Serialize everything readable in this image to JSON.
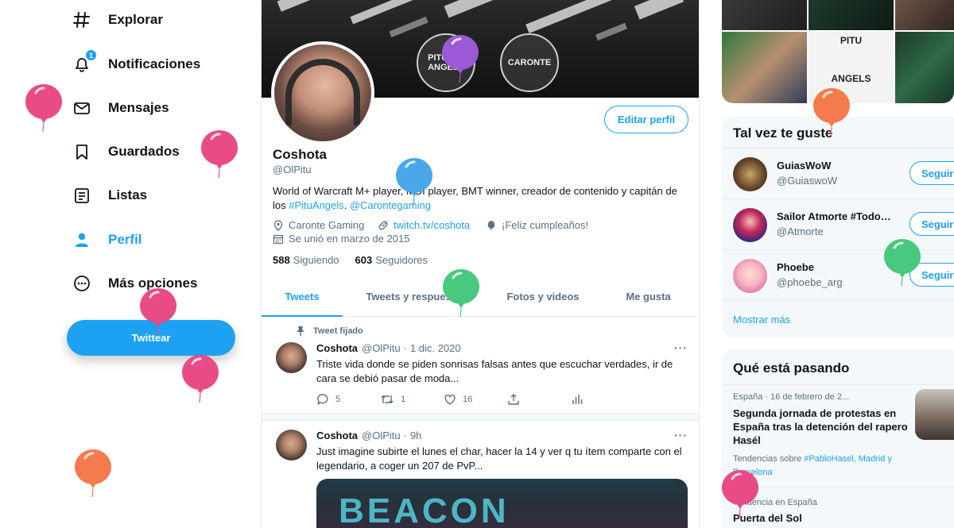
{
  "nav": {
    "items": [
      {
        "label": "Explorar"
      },
      {
        "label": "Notificaciones",
        "badge": "1"
      },
      {
        "label": "Mensajes"
      },
      {
        "label": "Guardados"
      },
      {
        "label": "Listas"
      },
      {
        "label": "Perfil"
      },
      {
        "label": "Más opciones"
      }
    ],
    "tweet_button": "Twittear",
    "accent": "#1da1f2"
  },
  "profile": {
    "banner_labels": [
      "PITU",
      "ANGELS",
      "CARONTE"
    ],
    "edit_button": "Editar perfil",
    "name": "Coshota",
    "handle": "@OlPitu",
    "bio_text": "World of Warcraft M+ player, MDI player, BMT winner, creador de contenido y capitán de los ",
    "bio_link1": "#PituAngels",
    "bio_sep": ". ",
    "bio_link2": "@Carontegaming",
    "location": "Caronte Gaming",
    "website": "twitch.tv/coshota",
    "birthday": "¡Feliz cumpleaños!",
    "joined": "Se unió en marzo de 2015",
    "following_count": "588",
    "following_label": "Siguiendo",
    "followers_count": "603",
    "followers_label": "Seguidores"
  },
  "tabs": [
    {
      "label": "Tweets",
      "active": true
    },
    {
      "label": "Tweets y respuestas"
    },
    {
      "label": "Fotos y videos"
    },
    {
      "label": "Me gusta"
    }
  ],
  "tweets": [
    {
      "pinned_label": "Tweet fijado",
      "name": "Coshota",
      "handle": "@OlPitu",
      "sep": "·",
      "time": "1 dic. 2020",
      "text": "Triste vida donde se piden sonrisas falsas antes que escuchar verdades, ir de cara se debió pasar de moda...",
      "replies": "5",
      "retweets": "1",
      "likes": "16"
    },
    {
      "name": "Coshota",
      "handle": "@OlPitu",
      "sep": "·",
      "time": "9h",
      "text": "Just imagine subirte el lunes el char, hacer la 14 y ver q tu ítem comparte con el legendario, a coger un 207 de PvP...",
      "media_text": "BEACON"
    }
  ],
  "sidebar": {
    "media_labels": [
      "PITU",
      "ANGELS"
    ],
    "suggest_title": "Tal vez te guste",
    "suggestions": [
      {
        "name": "GuiasWoW",
        "handle": "@GuiaswoW",
        "button": "Seguir"
      },
      {
        "name": "Sailor Atmorte #Todo…",
        "handle": "@Atmorte",
        "button": "Seguir"
      },
      {
        "name": "Phoebe",
        "handle": "@phoebe_arg",
        "button": "Seguir"
      }
    ],
    "show_more": "Mostrar más",
    "trends_title": "Qué está pasando",
    "trend1": {
      "meta": "España · 16 de febrero de 2...",
      "title": "Segunda jornada de protestas en España tras la detención del rapero Hasél",
      "more_prefix": "Tendencias sobre ",
      "more_highlight": "#PabloHasel, Madrid y Barcelona"
    },
    "trend2": {
      "meta": "Tendencia en España",
      "title": "Puerta del Sol"
    }
  },
  "balloon_colors": {
    "pink": "#e94b86",
    "blue": "#4aa8ea",
    "green": "#48c97f",
    "orange": "#f57b4f",
    "purple": "#9a5ad6"
  }
}
